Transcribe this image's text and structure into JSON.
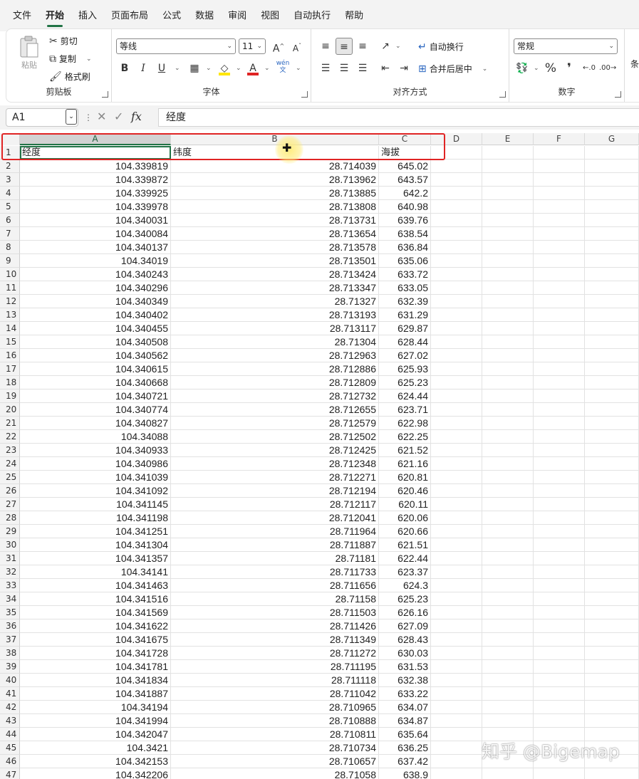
{
  "menu": {
    "tabs": [
      "文件",
      "开始",
      "插入",
      "页面布局",
      "公式",
      "数据",
      "审阅",
      "视图",
      "自动执行",
      "帮助"
    ],
    "active": "开始"
  },
  "ribbon": {
    "clipboard": {
      "paste": "粘贴",
      "cut": "剪切",
      "copy": "复制",
      "format_painter": "格式刷",
      "label": "剪贴板"
    },
    "font": {
      "family": "等线",
      "size": "11",
      "label": "字体",
      "wen_top": "wén",
      "wen_bottom": "文"
    },
    "align": {
      "wrap": "自动换行",
      "merge": "合并后居中",
      "label": "对齐方式"
    },
    "number": {
      "format": "常规",
      "label": "数字",
      "cond_partial": "条"
    }
  },
  "formula_bar": {
    "name_box": "A1",
    "fx": "fx",
    "value": "经度"
  },
  "columns": [
    "A",
    "B",
    "C",
    "D",
    "E",
    "F",
    "G"
  ],
  "headers": [
    "经度",
    "纬度",
    "海拔"
  ],
  "rows": [
    [
      "104.339819",
      "28.714039",
      "645.02"
    ],
    [
      "104.339872",
      "28.713962",
      "643.57"
    ],
    [
      "104.339925",
      "28.713885",
      "642.2"
    ],
    [
      "104.339978",
      "28.713808",
      "640.98"
    ],
    [
      "104.340031",
      "28.713731",
      "639.76"
    ],
    [
      "104.340084",
      "28.713654",
      "638.54"
    ],
    [
      "104.340137",
      "28.713578",
      "636.84"
    ],
    [
      "104.34019",
      "28.713501",
      "635.06"
    ],
    [
      "104.340243",
      "28.713424",
      "633.72"
    ],
    [
      "104.340296",
      "28.713347",
      "633.05"
    ],
    [
      "104.340349",
      "28.71327",
      "632.39"
    ],
    [
      "104.340402",
      "28.713193",
      "631.29"
    ],
    [
      "104.340455",
      "28.713117",
      "629.87"
    ],
    [
      "104.340508",
      "28.71304",
      "628.44"
    ],
    [
      "104.340562",
      "28.712963",
      "627.02"
    ],
    [
      "104.340615",
      "28.712886",
      "625.93"
    ],
    [
      "104.340668",
      "28.712809",
      "625.23"
    ],
    [
      "104.340721",
      "28.712732",
      "624.44"
    ],
    [
      "104.340774",
      "28.712655",
      "623.71"
    ],
    [
      "104.340827",
      "28.712579",
      "622.98"
    ],
    [
      "104.34088",
      "28.712502",
      "622.25"
    ],
    [
      "104.340933",
      "28.712425",
      "621.52"
    ],
    [
      "104.340986",
      "28.712348",
      "621.16"
    ],
    [
      "104.341039",
      "28.712271",
      "620.81"
    ],
    [
      "104.341092",
      "28.712194",
      "620.46"
    ],
    [
      "104.341145",
      "28.712117",
      "620.11"
    ],
    [
      "104.341198",
      "28.712041",
      "620.06"
    ],
    [
      "104.341251",
      "28.711964",
      "620.66"
    ],
    [
      "104.341304",
      "28.711887",
      "621.51"
    ],
    [
      "104.341357",
      "28.71181",
      "622.44"
    ],
    [
      "104.34141",
      "28.711733",
      "623.37"
    ],
    [
      "104.341463",
      "28.711656",
      "624.3"
    ],
    [
      "104.341516",
      "28.71158",
      "625.23"
    ],
    [
      "104.341569",
      "28.711503",
      "626.16"
    ],
    [
      "104.341622",
      "28.711426",
      "627.09"
    ],
    [
      "104.341675",
      "28.711349",
      "628.43"
    ],
    [
      "104.341728",
      "28.711272",
      "630.03"
    ],
    [
      "104.341781",
      "28.711195",
      "631.53"
    ],
    [
      "104.341834",
      "28.711118",
      "632.38"
    ],
    [
      "104.341887",
      "28.711042",
      "633.22"
    ],
    [
      "104.34194",
      "28.710965",
      "634.07"
    ],
    [
      "104.341994",
      "28.710888",
      "634.87"
    ],
    [
      "104.342047",
      "28.710811",
      "635.64"
    ],
    [
      "104.3421",
      "28.710734",
      "636.25"
    ],
    [
      "104.342153",
      "28.710657",
      "637.42"
    ],
    [
      "104.342206",
      "28.71058",
      "638.9"
    ]
  ],
  "watermark": "知乎 @Bigemap",
  "colors": {
    "accent": "#217346",
    "highlight_box": "#e02424"
  }
}
